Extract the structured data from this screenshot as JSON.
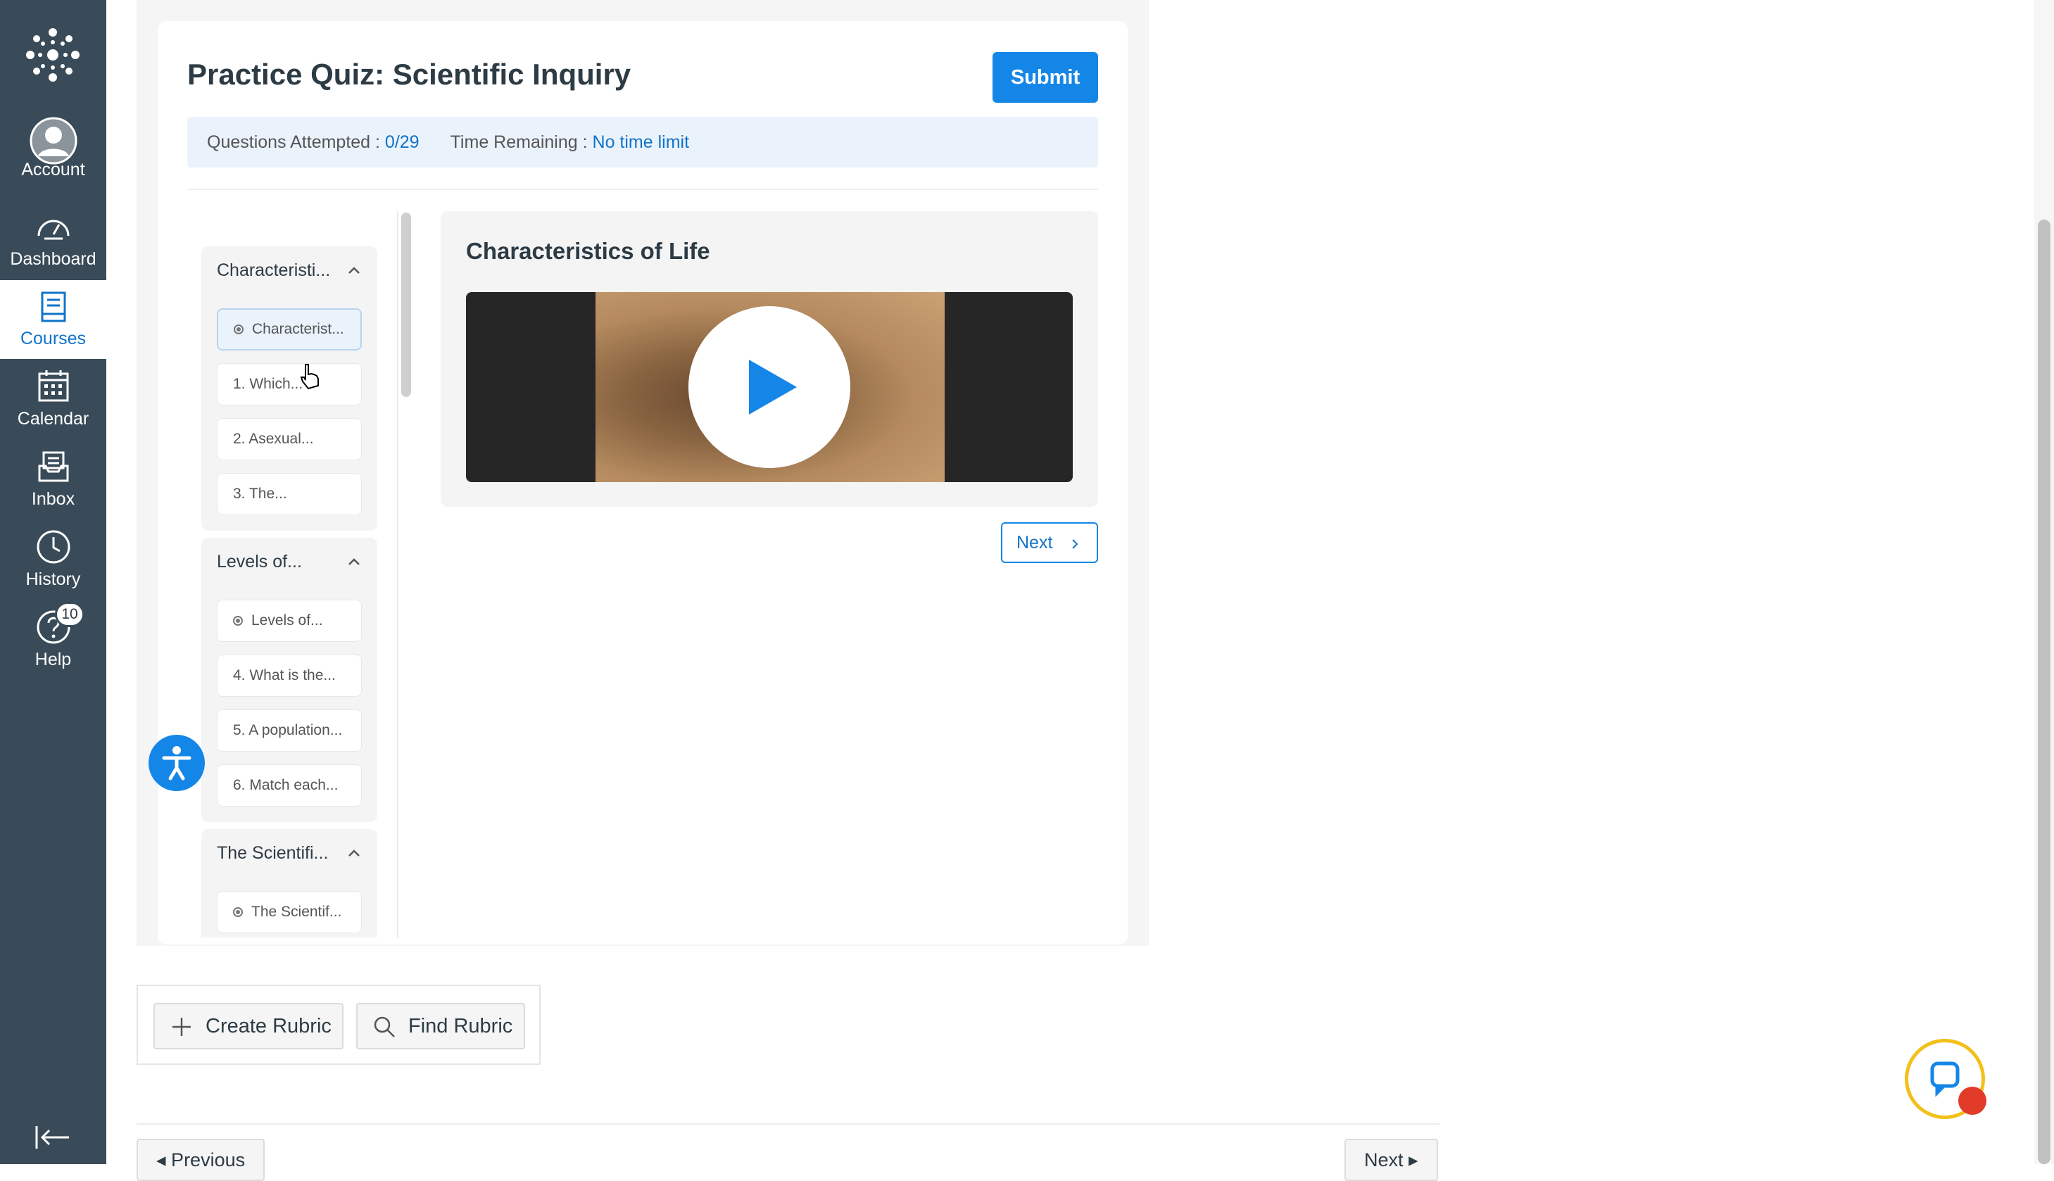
{
  "nav": {
    "items": [
      {
        "label": "Account",
        "icon": "account-icon"
      },
      {
        "label": "Dashboard",
        "icon": "dashboard-icon"
      },
      {
        "label": "Courses",
        "icon": "courses-icon",
        "active": true
      },
      {
        "label": "Calendar",
        "icon": "calendar-icon"
      },
      {
        "label": "Inbox",
        "icon": "inbox-icon"
      },
      {
        "label": "History",
        "icon": "history-icon"
      },
      {
        "label": "Help",
        "icon": "help-icon"
      }
    ],
    "help_badge": "10"
  },
  "quiz": {
    "title": "Practice Quiz: Scientific Inquiry",
    "submit_label": "Submit",
    "attempted_label": "Questions Attempted : ",
    "attempted_value": "0/29",
    "time_label": "Time Remaining : ",
    "time_value": "No time limit"
  },
  "outline": {
    "sections": [
      {
        "title": "Characteristi...",
        "items": [
          "Characterist...",
          "1. Which...",
          "2. Asexual...",
          "3. The..."
        ]
      },
      {
        "title": "Levels of...",
        "items": [
          "Levels of...",
          "4. What is the...",
          "5. A population...",
          "6. Match each..."
        ]
      },
      {
        "title": "The Scientifi...",
        "items": [
          "The Scientif..."
        ]
      }
    ]
  },
  "panel": {
    "title": "Characteristics of Life",
    "next_label": "Next"
  },
  "rubric": {
    "create_label": "Create Rubric",
    "find_label": "Find Rubric"
  },
  "pager": {
    "previous_label": "◂ Previous",
    "next_label": "Next ▸"
  },
  "colors": {
    "nav_bg": "#394b58",
    "accent": "#1486e8",
    "link": "#1173c9"
  }
}
